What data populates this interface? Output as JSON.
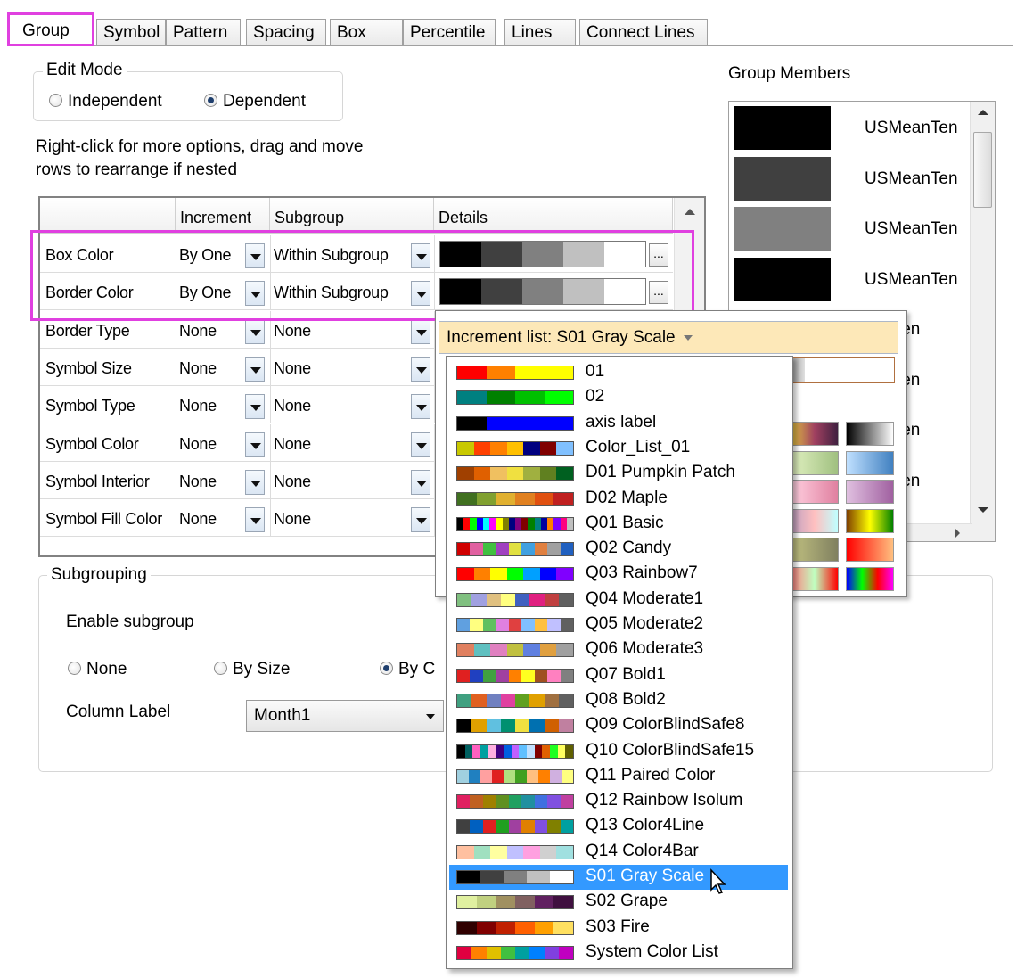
{
  "tabs": [
    {
      "label": "Group",
      "active": true
    },
    {
      "label": "Symbol"
    },
    {
      "label": "Pattern"
    },
    {
      "label": "Spacing"
    },
    {
      "label": "Box"
    },
    {
      "label": "Percentile"
    },
    {
      "label": "Lines"
    },
    {
      "label": "Connect Lines"
    }
  ],
  "edit_mode": {
    "title": "Edit Mode",
    "independent": "Independent",
    "dependent": "Dependent",
    "selected": "Dependent"
  },
  "hint": {
    "line1": "Right-click for more options, drag and move",
    "line2": "rows to  rearrange if nested"
  },
  "table": {
    "headers": [
      "",
      "Increment",
      "Subgroup",
      "Details"
    ],
    "rows": [
      {
        "name": "Box Color",
        "increment": "By One",
        "subgroup": "Within Subgroup",
        "details": [
          "#000000",
          "#404040",
          "#808080",
          "#c0c0c0",
          "#ffffff"
        ]
      },
      {
        "name": "Border Color",
        "increment": "By One",
        "subgroup": "Within Subgroup",
        "details": [
          "#000000",
          "#404040",
          "#808080",
          "#c0c0c0",
          "#ffffff"
        ]
      },
      {
        "name": "Border Type",
        "increment": "None",
        "subgroup": "None"
      },
      {
        "name": "Symbol Size",
        "increment": "None",
        "subgroup": "None"
      },
      {
        "name": "Symbol Type",
        "increment": "None",
        "subgroup": "None"
      },
      {
        "name": "Symbol Color",
        "increment": "None",
        "subgroup": "None"
      },
      {
        "name": "Symbol Interior",
        "increment": "None",
        "subgroup": "None"
      },
      {
        "name": "Symbol Fill Color",
        "increment": "None",
        "subgroup": "None"
      }
    ]
  },
  "subgrouping": {
    "title": "Subgrouping",
    "enable_label": "Enable subgroup",
    "none": "None",
    "by_size": "By Size",
    "by_column": "By C",
    "selected": "By C",
    "column_label": "Column Label",
    "column_value": "Month1"
  },
  "group_members": {
    "title": "Group Members",
    "items": [
      {
        "label": "USMeanTen",
        "color": "#000000"
      },
      {
        "label": "USMeanTen",
        "color": "#404040"
      },
      {
        "label": "USMeanTen",
        "color": "#808080"
      },
      {
        "label": "USMeanTen",
        "color": "#000000"
      },
      {
        "label": "eanTen"
      },
      {
        "label": "eanTen"
      },
      {
        "label": "eanTen"
      },
      {
        "label": "eanTen"
      }
    ]
  },
  "increment_list": {
    "header": "Increment list: S01 Gray Scale",
    "selected": "S01 Gray Scale",
    "items": [
      {
        "name": "01",
        "colors": [
          "#ff0000",
          "#ff8000",
          "#ffff00",
          "#ffff00"
        ]
      },
      {
        "name": "02",
        "colors": [
          "#008080",
          "#008000",
          "#00c000",
          "#00ff00"
        ]
      },
      {
        "name": "axis label",
        "colors": [
          "#000000",
          "#0000ff",
          "#0000ff",
          "#0000ff"
        ]
      },
      {
        "name": "Color_List_01",
        "colors": [
          "#c8c800",
          "#ff4000",
          "#ff8000",
          "#ffc000",
          "#000080",
          "#800000",
          "#80c0ff"
        ]
      },
      {
        "name": "D01 Pumpkin Patch",
        "colors": [
          "#a04000",
          "#e06000",
          "#f0c060",
          "#f0e040",
          "#a0b040",
          "#608020",
          "#006020"
        ]
      },
      {
        "name": "D02 Maple",
        "colors": [
          "#407020",
          "#80a030",
          "#e0b030",
          "#e08020",
          "#e05010",
          "#c02020"
        ]
      },
      {
        "name": "Q01 Basic",
        "colors": [
          "#000000",
          "#ff0000",
          "#00ff00",
          "#0000ff",
          "#00ffff",
          "#ff00ff",
          "#ffff00",
          "#808000",
          "#000080",
          "#800080",
          "#800000",
          "#008000",
          "#008080",
          "#0000a0",
          "#ff8000",
          "#8000ff",
          "#ff0080",
          "#c0c0c0"
        ]
      },
      {
        "name": "Q02 Candy",
        "colors": [
          "#d00000",
          "#e060a0",
          "#40c040",
          "#a040c0",
          "#e0e040",
          "#40a0e0",
          "#e08040",
          "#a0a0a0",
          "#2060c0"
        ]
      },
      {
        "name": "Q03 Rainbow7",
        "colors": [
          "#ff0000",
          "#ff8000",
          "#ffff00",
          "#00ff00",
          "#00a0ff",
          "#0000ff",
          "#8000ff"
        ]
      },
      {
        "name": "Q04 Moderate1",
        "colors": [
          "#80c080",
          "#a0a0e0",
          "#e0c080",
          "#ffff80",
          "#4060c0",
          "#e02080",
          "#c04040",
          "#606060"
        ]
      },
      {
        "name": "Q05 Moderate2",
        "colors": [
          "#60a0e0",
          "#ffff80",
          "#60c060",
          "#e080e0",
          "#e04040",
          "#80c0ff",
          "#ffc040",
          "#c0c0ff",
          "#606060"
        ]
      },
      {
        "name": "Q06 Moderate3",
        "colors": [
          "#e08060",
          "#60c0c0",
          "#e080c0",
          "#c0c040",
          "#6080e0",
          "#e0a040",
          "#a0a0a0"
        ]
      },
      {
        "name": "Q07 Bold1",
        "colors": [
          "#e02020",
          "#2040c0",
          "#40a040",
          "#a040a0",
          "#ff8000",
          "#ffff20",
          "#a05020",
          "#ff80c0",
          "#808080"
        ]
      },
      {
        "name": "Q08 Bold2",
        "colors": [
          "#40a080",
          "#e06020",
          "#7080c0",
          "#e040a0",
          "#60a020",
          "#e0a000",
          "#a07040",
          "#606060"
        ]
      },
      {
        "name": "Q09 ColorBlindSafe8",
        "colors": [
          "#000000",
          "#e0a000",
          "#60c0e0",
          "#009070",
          "#f0e040",
          "#0070b0",
          "#d06000",
          "#c080a0"
        ]
      },
      {
        "name": "Q10 ColorBlindSafe15",
        "colors": [
          "#000000",
          "#006060",
          "#ff60c0",
          "#00a0a0",
          "#ffb0e0",
          "#400080",
          "#0060e0",
          "#c060ff",
          "#60c0ff",
          "#c0e0ff",
          "#800000",
          "#e06000",
          "#20ff20",
          "#ffff60",
          "#606000"
        ]
      },
      {
        "name": "Q11 Paired Color",
        "colors": [
          "#a0d0e0",
          "#2080c0",
          "#ffa0a0",
          "#e02020",
          "#b0e080",
          "#40a020",
          "#ffc080",
          "#ff8000",
          "#d0b0e0",
          "#ffff80"
        ]
      },
      {
        "name": "Q12 Rainbow Isolum",
        "colors": [
          "#e02060",
          "#c06020",
          "#a08000",
          "#609020",
          "#20a060",
          "#2090a0",
          "#4070e0",
          "#8050e0",
          "#c040a0"
        ]
      },
      {
        "name": "Q13 Color4Line",
        "colors": [
          "#404040",
          "#0060c0",
          "#e02020",
          "#20a020",
          "#a040a0",
          "#e08000",
          "#8050e0",
          "#808000",
          "#00a0a0"
        ]
      },
      {
        "name": "Q14 Color4Bar",
        "colors": [
          "#ffc0a0",
          "#a0e0c0",
          "#ffffa0",
          "#c0c0ff",
          "#ffa0e0",
          "#d0d0d0",
          "#a0e0e0"
        ]
      },
      {
        "name": "S01 Gray Scale",
        "colors": [
          "#000000",
          "#404040",
          "#808080",
          "#c0c0c0",
          "#ffffff"
        ]
      },
      {
        "name": "S02 Grape",
        "colors": [
          "#e0f0a0",
          "#c0d080",
          "#a09060",
          "#806060",
          "#602060",
          "#401040"
        ]
      },
      {
        "name": "S03 Fire",
        "colors": [
          "#300000",
          "#800000",
          "#c02000",
          "#ff6000",
          "#ffa000",
          "#ffe060"
        ]
      },
      {
        "name": "System Color List",
        "colors": [
          "#e00040",
          "#ff8000",
          "#e0c000",
          "#40c040",
          "#00a0a0",
          "#0080ff",
          "#8040e0",
          "#c000c0"
        ]
      }
    ]
  },
  "gradient_swatches": [
    [
      "#e0c040",
      "#a04060",
      "#402040"
    ],
    [
      "#000000",
      "#ffffff"
    ],
    [
      "#e0f0c0",
      "#a0c080"
    ],
    [
      "#c0e0ff",
      "#4080c0"
    ],
    [
      "#ffd0e0",
      "#e080a0"
    ],
    [
      "#e0c0e0",
      "#a060a0"
    ],
    [
      "#c0a0c0",
      "#ffc0c0",
      "#c0ffff"
    ],
    [
      "#804000",
      "#ffff00",
      "#008000"
    ],
    [
      "#c0c080",
      "#808060"
    ],
    [
      "#ff0000",
      "#ffc080"
    ],
    [
      "#ff8080",
      "#c0ffc0",
      "#ff0000"
    ],
    [
      "#0000ff",
      "#00ff00",
      "#ff0000",
      "#ff00ff"
    ]
  ]
}
